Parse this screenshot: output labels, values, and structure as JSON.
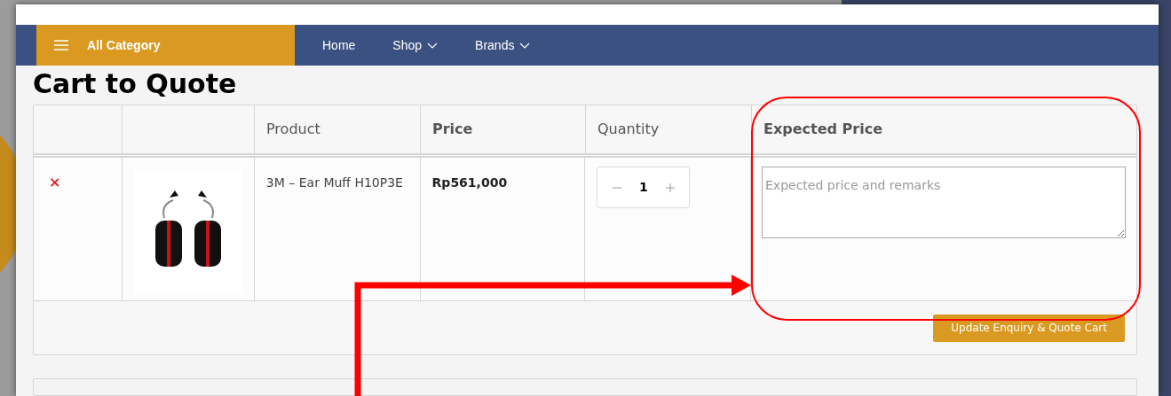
{
  "nav": {
    "category": "All Category",
    "items": [
      {
        "label": "Home",
        "dropdown": false
      },
      {
        "label": "Shop",
        "dropdown": true
      },
      {
        "label": "Brands",
        "dropdown": true
      }
    ]
  },
  "title": "Cart to Quote",
  "table": {
    "columns": [
      {},
      {},
      {
        "label": "Product",
        "bold": false
      },
      {
        "label": "Price",
        "bold": true
      },
      {
        "label": "Quantity",
        "bold": false
      },
      {
        "label": "Expected Price",
        "bold": true
      }
    ],
    "rows": [
      {
        "remove": "×",
        "product": "3M – Ear Muff H10P3E",
        "price": "Rp561,000",
        "quantity": "1",
        "remarks_placeholder": "Expected price and remarks"
      }
    ]
  },
  "update_button": "Update Enquiry & Quote Cart"
}
